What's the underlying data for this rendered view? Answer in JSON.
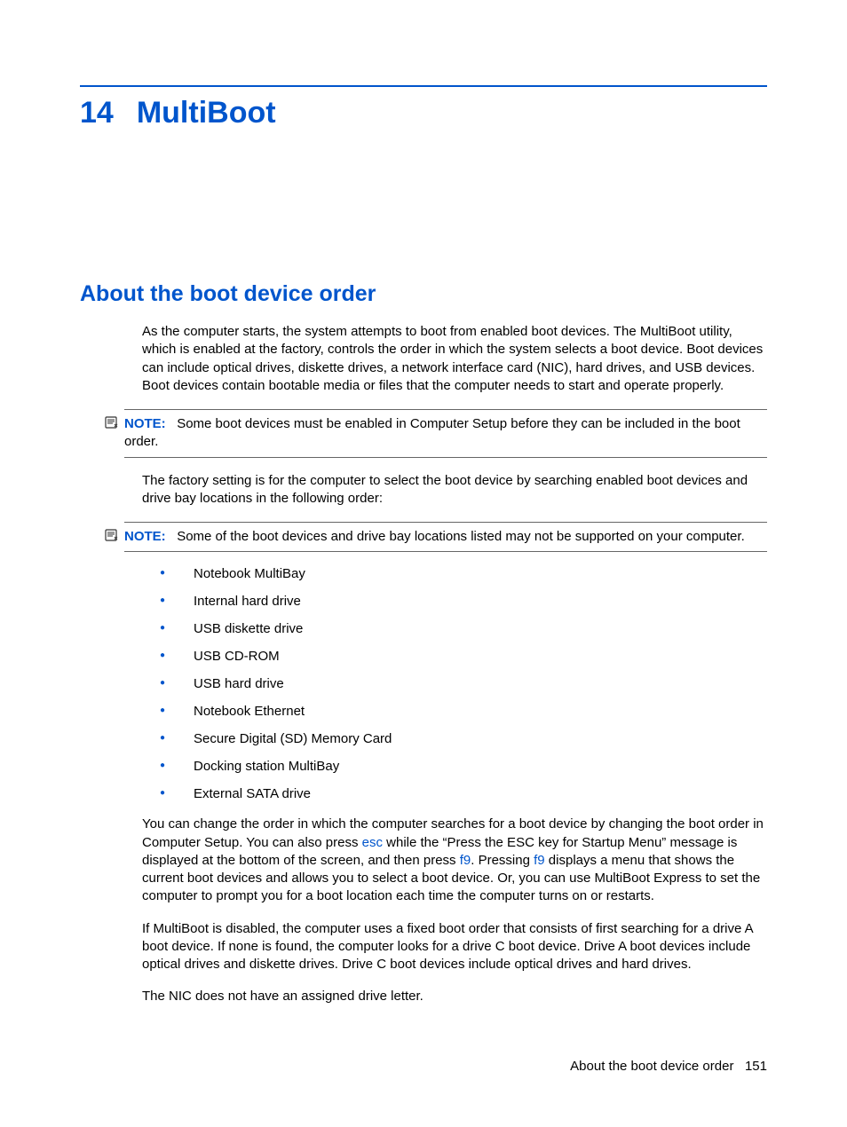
{
  "chapter": {
    "number": "14",
    "title": "MultiBoot"
  },
  "section": {
    "heading": "About the boot device order",
    "intro": "As the computer starts, the system attempts to boot from enabled boot devices. The MultiBoot utility, which is enabled at the factory, controls the order in which the system selects a boot device. Boot devices can include optical drives, diskette drives, a network interface card (NIC), hard drives, and USB devices. Boot devices contain bootable media or files that the computer needs to start and operate properly.",
    "note1_label": "NOTE:",
    "note1_text": "Some boot devices must be enabled in Computer Setup before they can be included in the boot order.",
    "factory_text": "The factory setting is for the computer to select the boot device by searching enabled boot devices and drive bay locations in the following order:",
    "note2_label": "NOTE:",
    "note2_text": "Some of the boot devices and drive bay locations listed may not be supported on your computer.",
    "boot_list": [
      "Notebook MultiBay",
      "Internal hard drive",
      "USB diskette drive",
      "USB CD-ROM",
      "USB hard drive",
      "Notebook Ethernet",
      "Secure Digital (SD) Memory Card",
      "Docking station MultiBay",
      "External SATA drive"
    ],
    "change_order": {
      "part1": "You can change the order in which the computer searches for a boot device by changing the boot order in Computer Setup. You can also press ",
      "key1": "esc",
      "part2": " while the “Press the ESC key for Startup Menu” message is displayed at the bottom of the screen, and then press ",
      "key2": "f9",
      "part3": ". Pressing ",
      "key3": "f9",
      "part4": " displays a menu that shows the current boot devices and allows you to select a boot device. Or, you can use MultiBoot Express to set the computer to prompt you for a boot location each time the computer turns on or restarts."
    },
    "disabled_text": "If MultiBoot is disabled, the computer uses a fixed boot order that consists of first searching for a drive A boot device. If none is found, the computer looks for a drive C boot device. Drive A boot devices include optical drives and diskette drives. Drive C boot devices include optical drives and hard drives.",
    "nic_text": "The NIC does not have an assigned drive letter."
  },
  "footer": {
    "text": "About the boot device order",
    "page": "151"
  }
}
